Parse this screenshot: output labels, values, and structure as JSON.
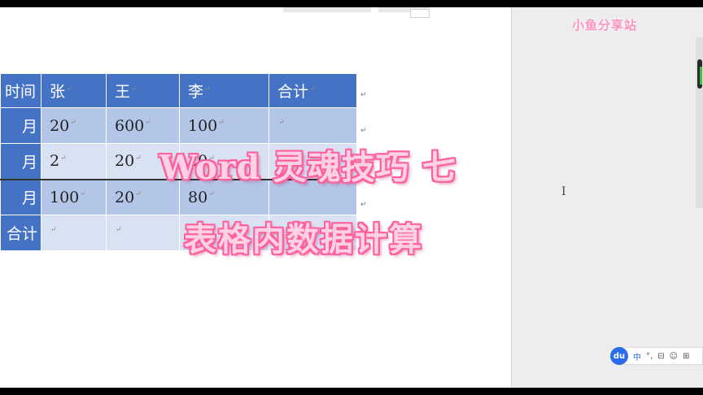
{
  "overlay": {
    "title": "Word 灵魂技巧 七",
    "subtitle": "表格内数据计算"
  },
  "watermark": "小鱼分享站",
  "table": {
    "header": [
      "时间",
      "张",
      "王",
      "李",
      "合计"
    ],
    "rows": [
      {
        "label": "月",
        "cells": [
          "20",
          "600",
          "100",
          ""
        ]
      },
      {
        "label": "月",
        "cells": [
          "2",
          "20",
          "20",
          ""
        ]
      },
      {
        "label": "月",
        "cells": [
          "100",
          "20",
          "80",
          ""
        ]
      },
      {
        "label": "合计",
        "cells": [
          "",
          "",
          "",
          ""
        ]
      }
    ]
  },
  "header_display": {
    "first": "时间"
  },
  "paragraph_mark": "↵",
  "text_cursor": "I",
  "ime": {
    "logo": "du",
    "mode": "中",
    "punct": "°,",
    "items": [
      "⊟",
      "⊞"
    ],
    "icons": [
      "baidu-ime-logo",
      "lang-toggle",
      "punctuation-icon",
      "toolbox-icon",
      "user-icon",
      "grid-icon"
    ]
  },
  "colors": {
    "table_header": "#4472c4",
    "row_dark": "#b4c6e7",
    "row_light": "#d9e2f3",
    "overlay_fill": "#ffd1e4",
    "overlay_stroke": "#ff5f9e",
    "watermark": "#ff8fbf"
  }
}
